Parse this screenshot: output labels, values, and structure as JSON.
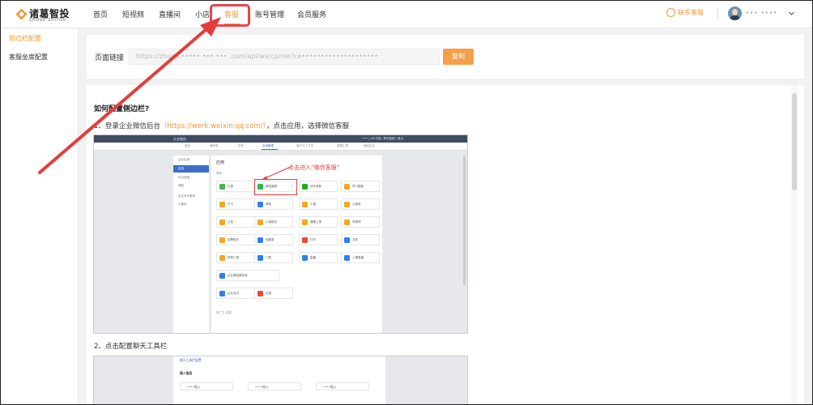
{
  "brand": {
    "name": "诸葛智投",
    "sub": "ZHUGE ZHITOU"
  },
  "nav": {
    "items": [
      "首页",
      "短视频",
      "直播间",
      "小店",
      "客服",
      "账号管理",
      "会员服务"
    ],
    "active": "客服"
  },
  "header": {
    "contact_label": "联系客服",
    "username": "••• ••••"
  },
  "sidebar": {
    "items": [
      "侧边栏配置",
      "客服坐席配置"
    ]
  },
  "link_card": {
    "label": "页面链接",
    "url_value": "https://zhuge.••••• ••• ••• .com/api/wx/cp/rse?ce••••••••••••••••••••",
    "copy_label": "复制"
  },
  "doc": {
    "title": "如何配置侧边栏?",
    "step1_prefix": "1、登录企业微信后台",
    "step1_url": "（https://work.weixin.qq.com/）",
    "step1_suffix": "，点击应用，选择微信客服",
    "step2": "2、点击配置聊天工具栏"
  },
  "screenshot1": {
    "logo": "企业微信",
    "topright": "•••• | API文档 | 联系客服 | 退出",
    "tabs": [
      "首页",
      "通讯录",
      "协作",
      "应用管理",
      "客户与上下游",
      "管理工具",
      "我的企业"
    ],
    "active_tab": "应用管理",
    "side_items": [
      "企业应用",
      "应用",
      "可见范围",
      "通知",
      "企业对外服务",
      "小程序"
    ],
    "side_selected": "应用",
    "heading": "应用",
    "subheading": "基础",
    "callout": "点击进入“微信客服”",
    "apps": [
      {
        "name": "汇报",
        "color": "#4caf50"
      },
      {
        "name": "微信客服",
        "color": "#3bb54a"
      },
      {
        "name": "对外收款",
        "color": "#1aad19"
      },
      {
        "name": "学习园地",
        "color": "#f5a623"
      },
      {
        "name": "打卡",
        "color": "#f5a623"
      },
      {
        "name": "审批",
        "color": "#2f80ed"
      },
      {
        "name": "汇报",
        "color": "#f5a623"
      },
      {
        "name": "公费电",
        "color": "#f5a623"
      },
      {
        "name": "公告",
        "color": "#f5a623"
      },
      {
        "name": "人事助手",
        "color": "#f5a623"
      },
      {
        "name": "健康上报",
        "color": "#f5a623"
      },
      {
        "name": "同事吧",
        "color": "#f5a623"
      },
      {
        "name": "发票助手",
        "color": "#f5a623"
      },
      {
        "name": "收集表",
        "color": "#2f80ed"
      },
      {
        "name": "打印",
        "color": "#e74c3c"
      },
      {
        "name": "文件",
        "color": "#2f80ed"
      },
      {
        "name": "效率工具",
        "color": "#f5a623"
      },
      {
        "name": "门禁",
        "color": "#2f80ed"
      },
      {
        "name": "直播",
        "color": "#2f80ed"
      },
      {
        "name": "上课直播",
        "color": "#2f80ed"
      },
      {
        "name": "企业微信服务商",
        "color": "#2f80ed"
      },
      {
        "name": "企业支付",
        "color": "#2f80ed"
      },
      {
        "name": "日程",
        "color": "#e74c3c"
      }
    ],
    "footer": "第三方  自建"
  },
  "screenshot2": {
    "line1": "聊天工具栏配置",
    "section": "插入信息",
    "buttons": [
      "••••插入",
      "••••插入",
      "••••插入"
    ]
  },
  "colors": {
    "accent": "#f09a37",
    "highlight": "#e8434a",
    "copy_button": "#f4a04a"
  }
}
